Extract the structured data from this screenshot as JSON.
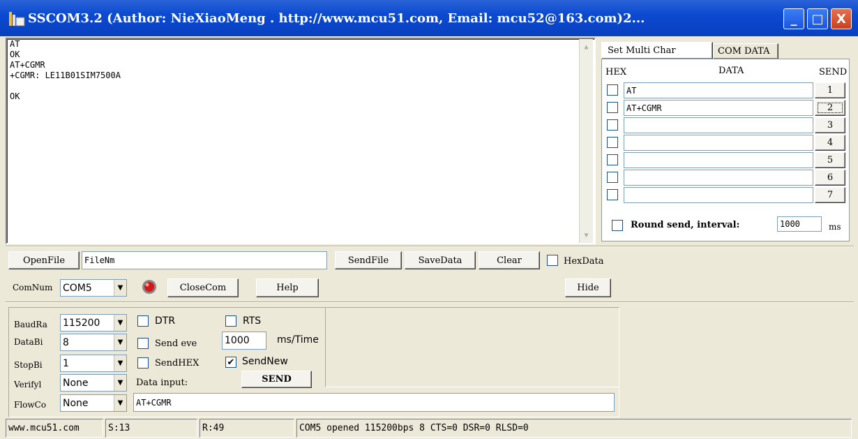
{
  "window": {
    "title": "SSCOM3.2 (Author: NieXiaoMeng .  http://www.mcu51.com,  Email: mcu52@163.com)2...",
    "minimize": "_",
    "maximize": "□",
    "close": "X"
  },
  "output": {
    "text": "AT\nOK\nAT+CGMR\n+CGMR: LE11B01SIM7500A\n\nOK"
  },
  "multi": {
    "tabs": [
      "Set Multi Char",
      "COM DATA"
    ],
    "col_hex": "HEX",
    "col_data": "DATA",
    "col_send": "SEND",
    "rows": [
      {
        "data": "AT",
        "send": "1"
      },
      {
        "data": "AT+CGMR",
        "send": "2"
      },
      {
        "data": "",
        "send": "3"
      },
      {
        "data": "",
        "send": "4"
      },
      {
        "data": "",
        "send": "5"
      },
      {
        "data": "",
        "send": "6"
      },
      {
        "data": "",
        "send": "7"
      }
    ],
    "round_send_label": "Round send, interval:",
    "interval_value": "1000",
    "interval_unit": "ms"
  },
  "filebar": {
    "open_file": "OpenFile",
    "file_name": "FileNm",
    "send_file": "SendFile",
    "save_data": "SaveData",
    "clear": "Clear",
    "hex_data": "HexData"
  },
  "combar": {
    "com_num_label": "ComNum",
    "com_num": "COM5",
    "close_com": "CloseCom",
    "help": "Help",
    "hide": "Hide"
  },
  "settings": {
    "baud_label": "BaudRa",
    "baud": "115200",
    "databits_label": "DataBi",
    "databits": "8",
    "stopbits_label": "StopBi",
    "stopbits": "1",
    "verify_label": "Verifyl",
    "verify": "None",
    "flow_label": "FlowCo",
    "flow": "None"
  },
  "controls": {
    "dtr": "DTR",
    "rts": "RTS",
    "send_every": "Send eve",
    "interval": "1000",
    "interval_unit": "ms/Time",
    "send_hex": "SendHEX",
    "send_new": "SendNew",
    "data_input_label": "Data input:",
    "send": "SEND",
    "input_value": "AT+CGMR"
  },
  "statusbar": {
    "site": "www.mcu51.com",
    "sent": "S:13",
    "received": "R:49",
    "port_status": "COM5 opened 115200bps  8  CTS=0 DSR=0 RLSD=0"
  }
}
